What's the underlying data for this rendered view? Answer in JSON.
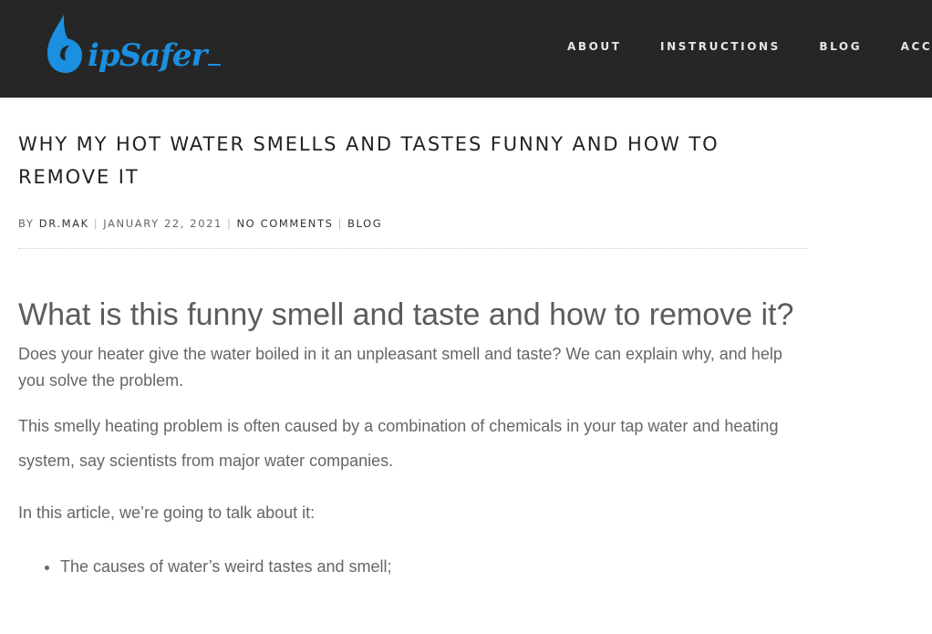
{
  "header": {
    "logo_text": "SipSafer",
    "nav": [
      {
        "label": "ABOUT"
      },
      {
        "label": "INSTRUCTIONS"
      },
      {
        "label": "BLOG"
      },
      {
        "label": "ACCOUN"
      }
    ]
  },
  "post": {
    "title": "WHY MY HOT WATER SMELLS AND TASTES FUNNY AND HOW TO REMOVE IT",
    "meta": {
      "by": "BY",
      "author": "DR.MAK",
      "separator": "|",
      "date": "JANUARY 22, 2021",
      "comments": "NO COMMENTS",
      "category": "BLOG"
    },
    "heading": "What is this funny smell and taste and how to remove it?",
    "paragraphs": [
      "Does your heater give the water boiled in it an unpleasant smell and taste? We can explain why, and help you solve the problem.",
      "This smelly heating problem is often caused by a combination of chemicals in your tap water and heating system, say scientists from major water companies.",
      "In this article, we’re going to talk about it:"
    ],
    "list": [
      "The causes of water’s weird tastes and smell;"
    ]
  },
  "colors": {
    "header_bg": "#262626",
    "logo_blue": "#1b8fe0"
  }
}
